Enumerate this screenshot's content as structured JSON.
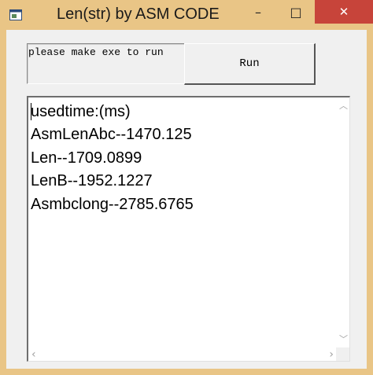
{
  "window": {
    "title": "Len(str) by ASM CODE",
    "icon": "app-window-icon",
    "controls": {
      "minimize": "–",
      "maximize": "□",
      "close": "✕"
    }
  },
  "info_label": "please make exe to run",
  "run_button": "Run",
  "output": {
    "lines": [
      "usedtime:(ms)",
      "AsmLenAbc--1470.125",
      "Len--1709.0899",
      "LenB--1952.1227",
      "Asmbclong--2785.6765"
    ]
  },
  "colors": {
    "titlebar": "#e9c586",
    "close_button": "#c7443a",
    "client": "#f0f0f0"
  }
}
